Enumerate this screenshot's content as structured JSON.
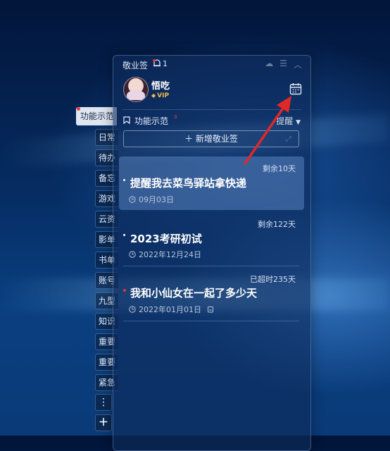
{
  "app": {
    "title": "敬业签",
    "notify_count": "1"
  },
  "user": {
    "name": "悟吃",
    "badge": "VIP"
  },
  "section": {
    "label": "功能示范",
    "sup": "3",
    "remind_label": "提醒"
  },
  "add_button": {
    "label": "＋ 新增敬业签"
  },
  "sidebar": {
    "active": "功能示范",
    "items": [
      "日常",
      "待办",
      "备忘",
      "游戏",
      "云资",
      "影单",
      "书单",
      "账号",
      "九型",
      "知识",
      "重要",
      "重要",
      "紧急"
    ],
    "more_symbol": "⋮",
    "add_symbol": "＋"
  },
  "notes": [
    {
      "remaining": "剩余10天",
      "title": "提醒我去菜鸟驿站拿快递",
      "date": "09月03日",
      "highlighted": true,
      "bullet": "white"
    },
    {
      "remaining": "剩余122天",
      "title": "2023考研初试",
      "date": "2022年12月24日",
      "highlighted": false,
      "bullet": "white"
    },
    {
      "remaining": "已超时235天",
      "title": "我和小仙女在一起了多少天",
      "date": "2022年01月01日",
      "highlighted": false,
      "bullet": "red"
    }
  ],
  "icons": [
    "bell-icon",
    "cloud-icon",
    "menu-icon",
    "collapse-icon",
    "calendar-icon",
    "bookmark-icon",
    "clock-icon",
    "clipboard-icon"
  ],
  "colors": {
    "panel": "#0e2c5c",
    "accent_red": "#e53935",
    "vip_gold": "#f2b64a",
    "arrow_red": "#e02828"
  }
}
